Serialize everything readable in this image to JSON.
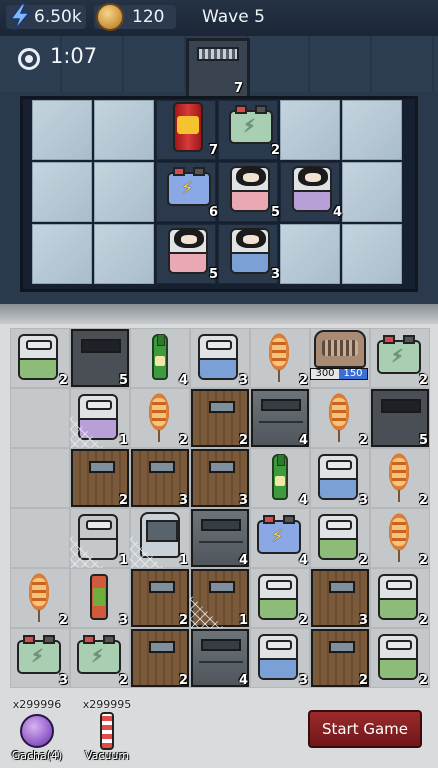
{
  "hud": {
    "energy": "6.50k",
    "coins": "120",
    "wave": "Wave 5"
  },
  "room": {
    "timer": "1:07",
    "door_level": "7",
    "items": [
      {
        "type": "can",
        "level": "7"
      },
      {
        "type": "battery-green",
        "level": "2"
      },
      {
        "type": "battery-blue",
        "level": "6"
      },
      {
        "type": "bed-pink-sleeper",
        "level": "5"
      },
      {
        "type": "bed-purple-sleeper",
        "level": "4"
      },
      {
        "type": "bed-pink-sleeper",
        "level": "5"
      },
      {
        "type": "bed-blue-sleeper",
        "level": "3"
      }
    ]
  },
  "grid": {
    "items": [
      {
        "type": "bed-green",
        "level": "2"
      },
      {
        "type": "door-dark",
        "level": "5"
      },
      {
        "type": "bottle",
        "level": "4"
      },
      {
        "type": "bed-blue",
        "level": "3"
      },
      {
        "type": "skewer",
        "level": "2"
      },
      {
        "type": "radio",
        "hp": "300",
        "hp_max": "150"
      },
      {
        "type": "battery-green",
        "level": "2"
      },
      {
        "type": "bed-purple-web",
        "level": "1"
      },
      {
        "type": "skewer",
        "level": "2"
      },
      {
        "type": "door-wood",
        "level": "2"
      },
      {
        "type": "door-steel",
        "level": "4"
      },
      {
        "type": "skewer",
        "level": "2"
      },
      {
        "type": "door-dark",
        "level": "5"
      },
      {
        "type": "door-wood",
        "level": "2"
      },
      {
        "type": "door-wood",
        "level": "3"
      },
      {
        "type": "door-wood",
        "level": "3"
      },
      {
        "type": "bottle",
        "level": "4"
      },
      {
        "type": "bed-blue",
        "level": "3"
      },
      {
        "type": "skewer",
        "level": "2"
      },
      {
        "type": "bed-red-web",
        "level": "1"
      },
      {
        "type": "fan-web",
        "level": "1"
      },
      {
        "type": "door-steel",
        "level": "4"
      },
      {
        "type": "battery-blue",
        "level": "4"
      },
      {
        "type": "bed-green",
        "level": "2"
      },
      {
        "type": "skewer",
        "level": "2"
      },
      {
        "type": "skewer",
        "level": "2"
      },
      {
        "type": "torch",
        "level": "3"
      },
      {
        "type": "door-wood",
        "level": "2"
      },
      {
        "type": "door-wood-web",
        "level": "1"
      },
      {
        "type": "bed-green",
        "level": "2"
      },
      {
        "type": "door-wood",
        "level": "3"
      },
      {
        "type": "bed-green",
        "level": "2"
      },
      {
        "type": "battery-green",
        "level": "3"
      },
      {
        "type": "battery-green",
        "level": "2"
      },
      {
        "type": "door-wood",
        "level": "2"
      },
      {
        "type": "door-steel",
        "level": "4"
      },
      {
        "type": "bed-blue",
        "level": "3"
      },
      {
        "type": "door-wood",
        "level": "2"
      },
      {
        "type": "bed-green",
        "level": "2"
      }
    ]
  },
  "toolbar": {
    "gacha_count": "x299996",
    "gacha_label": "Gacha(4)",
    "vacuum_count": "x299995",
    "vacuum_label": "Vacuum",
    "start_label": "Start Game"
  },
  "colors": {
    "start_button": "#8a2225",
    "room_wall": "#2a394b",
    "grid_bg": "#d9dbdd"
  }
}
